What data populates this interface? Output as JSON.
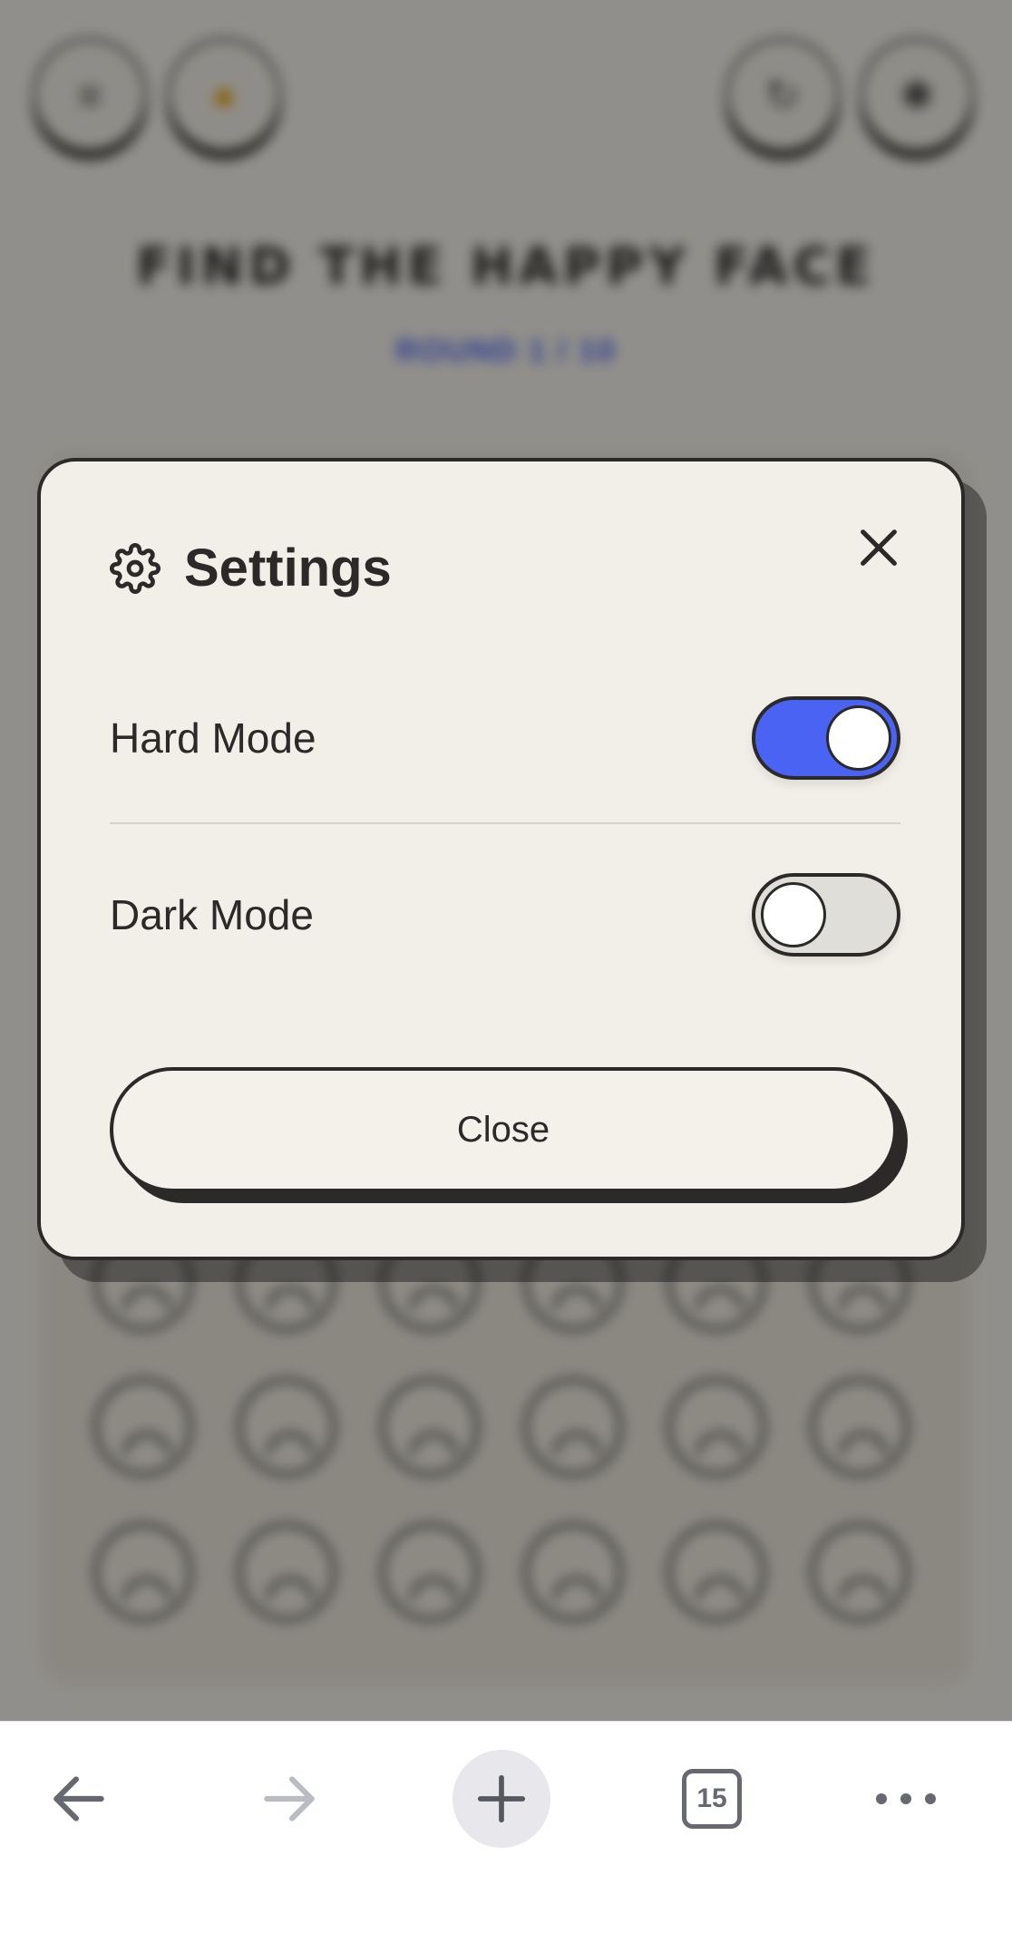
{
  "game_background": {
    "title": "FIND THE HAPPY FACE",
    "round": "ROUND 1 / 10"
  },
  "settings_modal": {
    "title": "Settings",
    "icons": {
      "settings": "gear-icon",
      "close": "close-icon"
    },
    "hard_mode": {
      "label": "Hard Mode",
      "enabled": true
    },
    "dark_mode": {
      "label": "Dark Mode",
      "enabled": false
    },
    "close_label": "Close"
  },
  "browser_bar": {
    "tab_count": "15",
    "icons": [
      "arrow-left-icon",
      "arrow-right-icon",
      "plus-icon",
      "tabs-icon",
      "more-icon"
    ]
  },
  "colors": {
    "accent": "#4a63f2",
    "ink": "#2b2a28",
    "modal_bg": "#f1efe7",
    "toggle_off": "#e0ded8"
  }
}
